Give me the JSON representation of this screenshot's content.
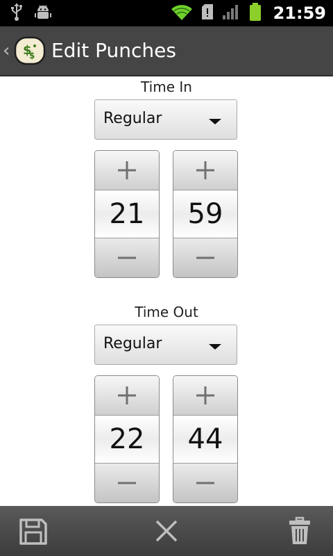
{
  "status_bar": {
    "time": "21:59",
    "icons": [
      "usb-icon",
      "android-debug-icon",
      "wifi-icon",
      "sd-card-icon",
      "signal-icon",
      "battery-icon"
    ]
  },
  "action_bar": {
    "title": "Edit Punches"
  },
  "time_in": {
    "label": "Time In",
    "type": "Regular",
    "hour": "21",
    "minute": "59"
  },
  "time_out": {
    "label": "Time Out",
    "type": "Regular",
    "hour": "22",
    "minute": "44"
  },
  "bottom_bar": {
    "icons": [
      "save-icon",
      "discard-icon",
      "delete-icon"
    ]
  },
  "colors": {
    "action_bar": "#454545",
    "status_bar": "#000000",
    "bottom_bar": "#4a4a4a",
    "battery": "#8ccf2a",
    "wifi": "#6fd12c"
  }
}
